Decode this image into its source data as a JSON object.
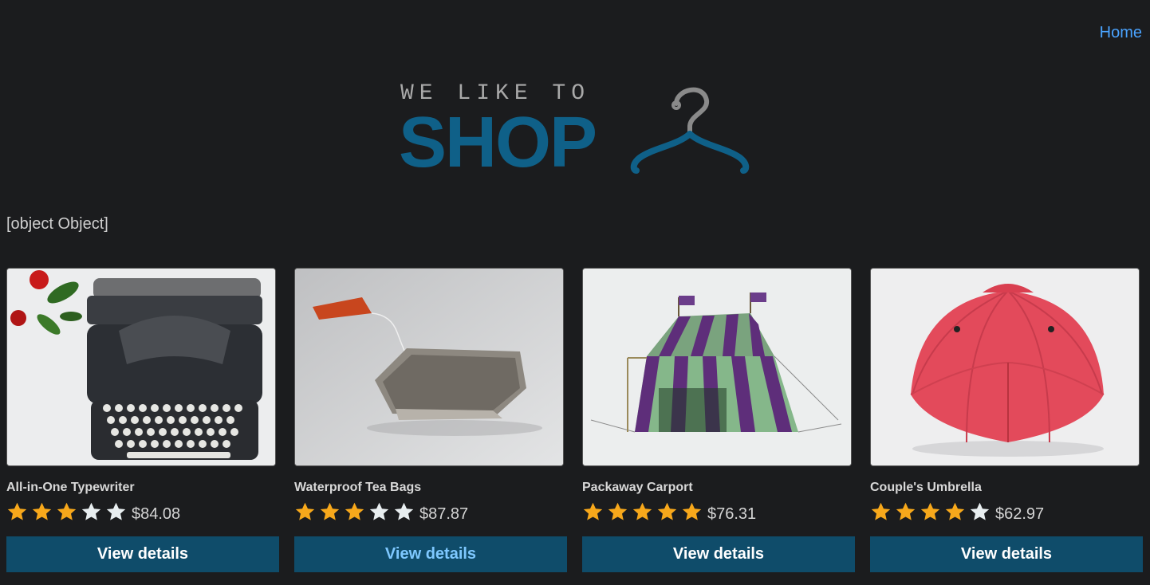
{
  "nav": {
    "home_label": "Home"
  },
  "logo": {
    "small_text": "WE LIKE TO",
    "big_text": "SHOP",
    "icon": "hanger-icon"
  },
  "debug_text": "[object Object]",
  "colors": {
    "background": "#1b1c1e",
    "accent": "#0f6088",
    "button": "#0f4c6a",
    "link": "#4aa3ff",
    "star_filled": "#f7a81b",
    "star_empty": "#e8eef0"
  },
  "products": [
    {
      "title": "All-in-One Typewriter",
      "rating": 3,
      "max_rating": 5,
      "price": "$84.08",
      "button_label": "View details",
      "image": "typewriter-image"
    },
    {
      "title": "Waterproof Tea Bags",
      "rating": 3,
      "max_rating": 5,
      "price": "$87.87",
      "button_label": "View details",
      "image": "tea-bag-image"
    },
    {
      "title": "Packaway Carport",
      "rating": 5,
      "max_rating": 5,
      "price": "$76.31",
      "button_label": "View details",
      "image": "tent-image"
    },
    {
      "title": "Couple's Umbrella",
      "rating": 4,
      "max_rating": 5,
      "price": "$62.97",
      "button_label": "View details",
      "image": "umbrella-image"
    }
  ]
}
